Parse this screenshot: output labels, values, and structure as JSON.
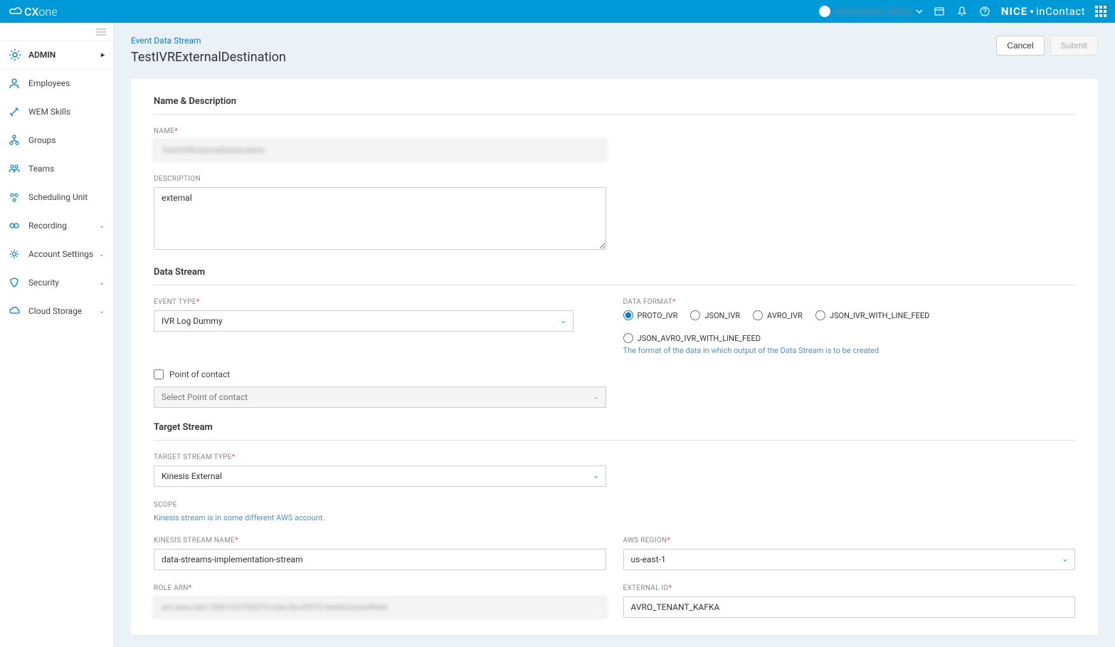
{
  "topbar": {
    "logo_cx": "CX",
    "logo_one": "one",
    "user_name": "Administrator Billing",
    "brand_nice": "NICE",
    "brand_incontact": "inContact"
  },
  "sidebar": {
    "title": "ADMIN",
    "items": [
      {
        "label": "Employees",
        "expandable": false
      },
      {
        "label": "WEM Skills",
        "expandable": false
      },
      {
        "label": "Groups",
        "expandable": false
      },
      {
        "label": "Teams",
        "expandable": false
      },
      {
        "label": "Scheduling Unit",
        "expandable": false
      },
      {
        "label": "Recording",
        "expandable": true
      },
      {
        "label": "Account Settings",
        "expandable": true
      },
      {
        "label": "Security",
        "expandable": true
      },
      {
        "label": "Cloud Storage",
        "expandable": true
      }
    ]
  },
  "page": {
    "breadcrumb": "Event Data Stream",
    "title": "TestIVRExternalDestination",
    "cancel": "Cancel",
    "submit": "Submit"
  },
  "sections": {
    "name_desc": "Name & Description",
    "data_stream": "Data Stream",
    "target_stream": "Target Stream"
  },
  "fields": {
    "name_label": "NAME",
    "name_value": "TestIVRExternalDestination",
    "desc_label": "DESCRIPTION",
    "desc_value": "external",
    "event_type_label": "EVENT TYPE",
    "event_type_value": "IVR Log Dummy",
    "poc_check_label": "Point of contact",
    "poc_select_placeholder": "Select Point of contact",
    "data_format_label": "DATA FORMAT",
    "data_format_help": "The format of the data in which output of the Data Stream is to be created",
    "data_format_options": [
      "PROTO_IVR",
      "JSON_IVR",
      "AVRO_IVR",
      "JSON_IVR_WITH_LINE_FEED",
      "JSON_AVRO_IVR_WITH_LINE_FEED"
    ],
    "data_format_selected": "PROTO_IVR",
    "target_type_label": "TARGET STREAM TYPE",
    "target_type_value": "Kinesis External",
    "scope_label": "SCOPE",
    "scope_help": "Kinesis stream is in some different AWS account.",
    "kinesis_name_label": "KINESIS STREAM NAME",
    "kinesis_name_value": "data-streams-implementation-stream",
    "aws_region_label": "AWS REGION",
    "aws_region_value": "us-east-1",
    "role_arn_label": "ROLE ARN",
    "role_arn_value": "arn:aws:iam::000102703076:role/ds-DSTO-testAccountRole",
    "external_id_label": "EXTERNAL ID",
    "external_id_value": "AVRO_TENANT_KAFKA"
  }
}
